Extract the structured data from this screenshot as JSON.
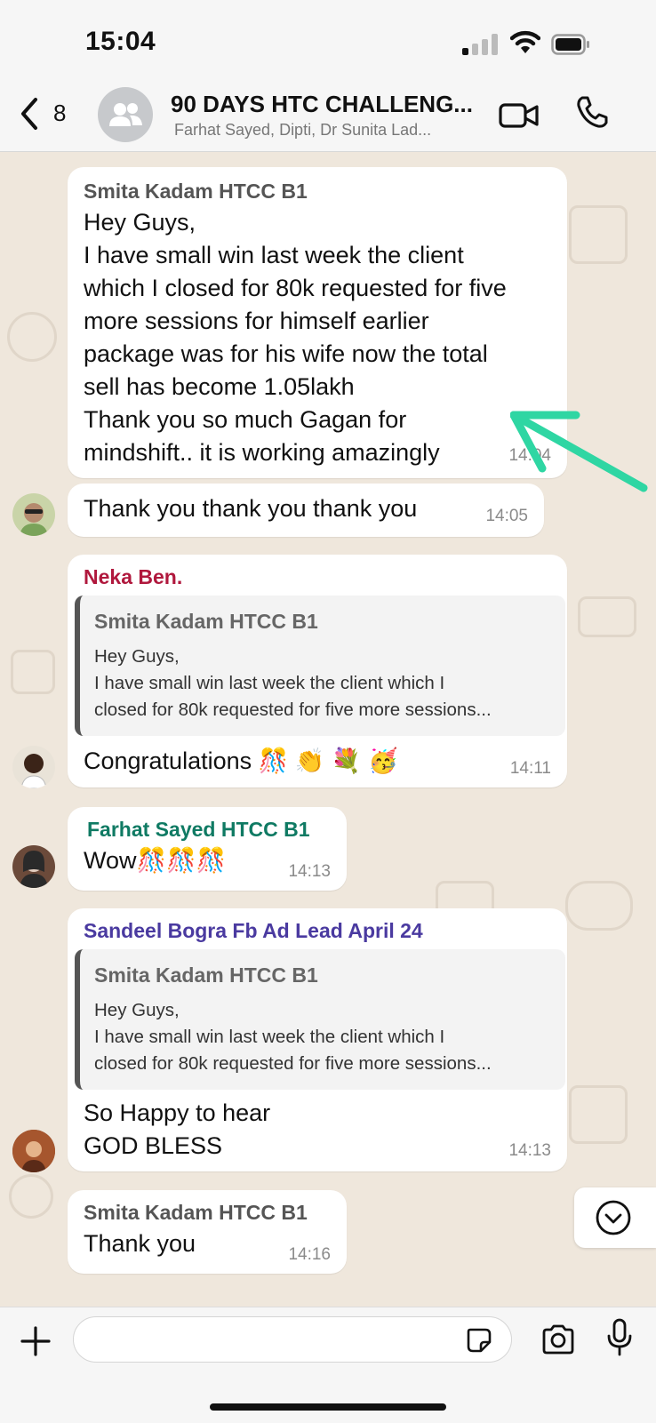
{
  "status_bar": {
    "time": "15:04"
  },
  "header": {
    "back_count": "8",
    "title": "90 DAYS HTC CHALLENG...",
    "subtitle": "Farhat Sayed, Dipti, Dr Sunita Lad..."
  },
  "colors": {
    "chat_bg": "#efe7dc",
    "arrow": "#2fd6a3",
    "neka": "#b0183d",
    "farhat": "#0f7a63",
    "sandeel": "#4a3aa0"
  },
  "messages": [
    {
      "sender": "Smita Kadam  HTCC B1",
      "text": "Hey Guys,\nI have small win last week the client\nwhich I closed for 80k requested for five\nmore sessions for himself earlier\npackage was for his wife now the total\nsell has become 1.05lakh\nThank you so much Gagan for\nmindshift.. it is working amazingly",
      "time": "14:04"
    },
    {
      "text": "Thank you thank you thank you",
      "time": "14:05"
    },
    {
      "sender": "Neka Ben.",
      "quote": {
        "name": "Smita Kadam  HTCC B1",
        "text": "Hey Guys,\nI have small win last week the client which I\nclosed for 80k requested for five more sessions..."
      },
      "text": "Congratulations 🎊 👏 💐 🥳",
      "time": "14:11"
    },
    {
      "sender": "Farhat Sayed HTCC B1",
      "text": "Wow🎊🎊🎊",
      "time": "14:13"
    },
    {
      "sender": "Sandeel Bogra  Fb Ad Lead April 24",
      "quote": {
        "name": "Smita Kadam  HTCC B1",
        "text": "Hey Guys,\nI have small win last week the client which I\nclosed for 80k requested for five more sessions..."
      },
      "text": "So Happy to hear\nGOD BLESS",
      "time": "14:13"
    },
    {
      "sender": "Smita Kadam  HTCC B1",
      "text": "Thank you",
      "time": "14:16"
    }
  ],
  "input": {
    "placeholder": ""
  },
  "icons": [
    "back-chevron-icon",
    "group-icon",
    "video-call-icon",
    "phone-icon",
    "scroll-down-icon",
    "plus-icon",
    "sticker-icon",
    "camera-icon",
    "microphone-icon"
  ]
}
